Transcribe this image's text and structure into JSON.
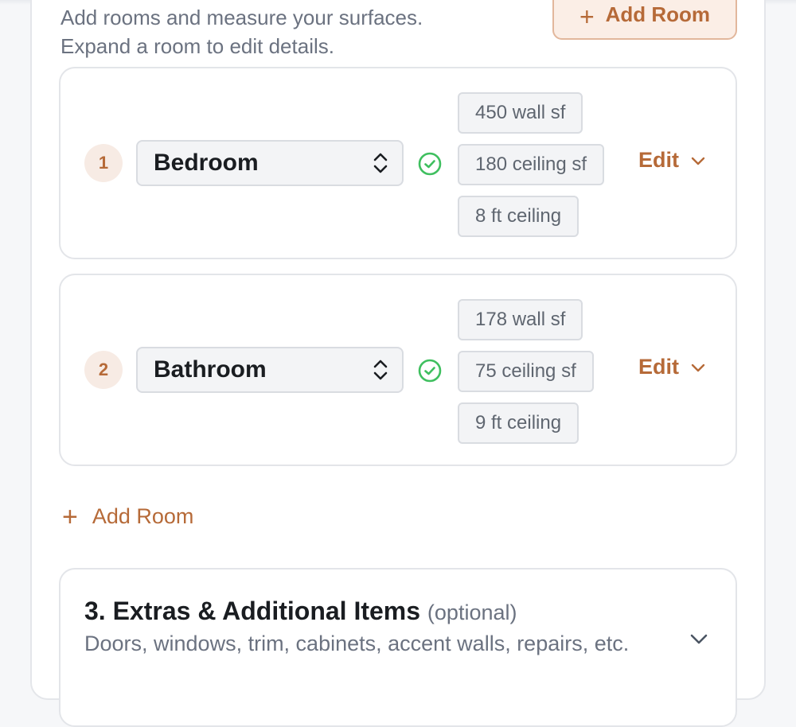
{
  "intro": {
    "line1": "Add rooms and measure your surfaces.",
    "line2": "Expand a room to edit details."
  },
  "header_button": {
    "icon": "plus-icon",
    "label": "Add Room"
  },
  "rooms": [
    {
      "number": "1",
      "name": "Bedroom",
      "status_icon": "check-circle-icon",
      "wall": "450 wall sf",
      "ceiling_area": "180 ceiling sf",
      "ceiling_height": "8 ft ceiling",
      "edit_label": "Edit"
    },
    {
      "number": "2",
      "name": "Bathroom",
      "status_icon": "check-circle-icon",
      "wall": "178 wall sf",
      "ceiling_area": "75 ceiling sf",
      "ceiling_height": "9 ft ceiling",
      "edit_label": "Edit"
    }
  ],
  "add_room_link": {
    "icon": "plus-icon",
    "label": "Add Room"
  },
  "extras": {
    "title": "3. Extras & Additional Items",
    "optional": "(optional)",
    "description": "Doors, windows, trim, cabinets, accent walls, repairs, etc."
  },
  "colors": {
    "accent": "#b66a38",
    "success": "#3fbf5f",
    "muted_text": "#6b7280"
  }
}
